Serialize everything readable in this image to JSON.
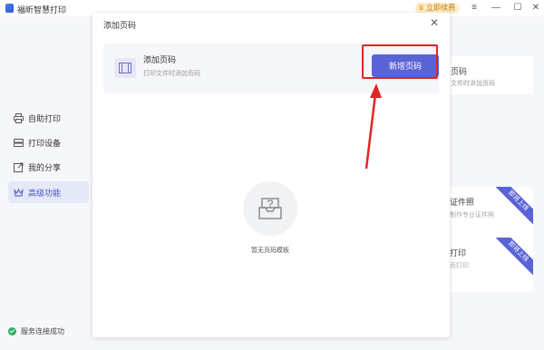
{
  "app": {
    "title": "福昕智慧打印",
    "vip_label": "立即续费"
  },
  "window_controls": {
    "menu": "≡",
    "minimize": "—",
    "maximize": "☐",
    "close": "✕"
  },
  "sidebar": {
    "items": [
      {
        "label": "自助打印",
        "icon": "printer-icon"
      },
      {
        "label": "打印设备",
        "icon": "device-icon"
      },
      {
        "label": "我的分享",
        "icon": "share-icon"
      },
      {
        "label": "高级功能",
        "icon": "crown-icon",
        "active": true
      }
    ],
    "status": "服务连接成功"
  },
  "background": {
    "card_title": "页码",
    "card_desc": "文件时添加页码",
    "features": [
      {
        "title": "证件照",
        "desc": "制作专业证件照",
        "badge": "即将上线"
      },
      {
        "title": "打印",
        "desc": "页打印",
        "badge": "即将上线"
      }
    ]
  },
  "modal": {
    "title": "添加页码",
    "close": "✕",
    "row": {
      "title": "添加页码",
      "desc": "打印文件时添加页码",
      "button": "新增页码"
    },
    "empty_text": "暂无页码模板"
  },
  "colors": {
    "accent": "#5a64d6",
    "highlight": "#e02525",
    "status_ok": "#2bb15f"
  }
}
